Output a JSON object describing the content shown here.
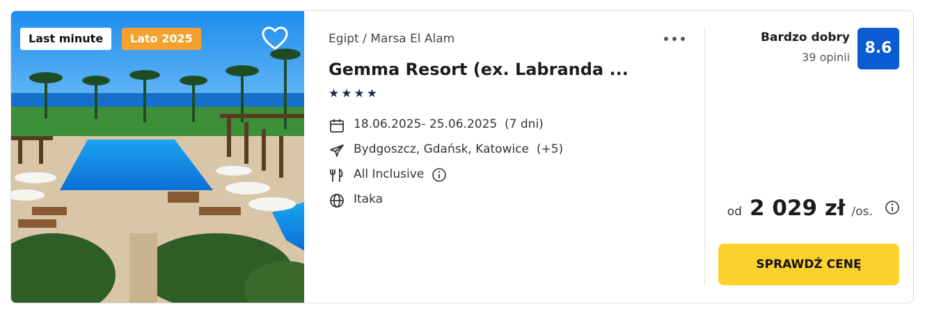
{
  "image": {
    "badges": {
      "last_minute": "Last minute",
      "season": "Lato 2025"
    },
    "favorite_icon": "heart-outline-icon"
  },
  "offer": {
    "location": "Egipt / Marsa El Alam",
    "title": "Gemma Resort (ex. Labranda ...",
    "stars": "★★★★",
    "star_count": 4,
    "more_icon": "more-horizontal-icon",
    "details": {
      "dates": "18.06.2025- 25.06.2025",
      "duration": "(7 dni)",
      "departures": "Bydgoszcz, Gdańsk, Katowice",
      "departures_more": "(+5)",
      "board": "All Inclusive",
      "operator": "Itaka"
    }
  },
  "rating": {
    "label": "Bardzo dobry",
    "count": "39 opinii",
    "score": "8.6"
  },
  "price": {
    "prefix": "od",
    "value": "2 029 zł",
    "per": "/os."
  },
  "cta": {
    "label": "SPRAWDŹ CENĘ"
  },
  "colors": {
    "score_bg": "#0b5bd3",
    "cta_bg": "#fdd22c",
    "badge_season": "#f6a12e",
    "stars": "#1f2a44"
  }
}
